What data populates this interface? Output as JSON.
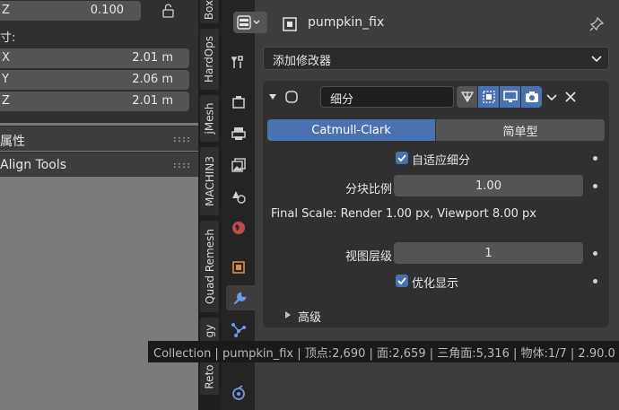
{
  "transform": {
    "scale_z": {
      "axis": "Z",
      "value": "0.100"
    },
    "dimensions_label": "寸:",
    "dimensions": [
      {
        "axis": "X",
        "value": "2.01 m"
      },
      {
        "axis": "Y",
        "value": "2.06 m"
      },
      {
        "axis": "Z",
        "value": "2.01 m"
      }
    ]
  },
  "panels": {
    "properties": "属性",
    "align_tools": "Align Tools"
  },
  "tabs": [
    "Box",
    "HardOps",
    "Mesh",
    "MACHIN3",
    "Quad Remesh",
    "Retopology"
  ],
  "tab_visible_text": {
    "box": "Box",
    "hardops": "HardOps",
    "mesh": "jMesh",
    "machin3": "MACHIN3",
    "quad": "Quad Remesh",
    "retopo": "Reto",
    "retopo2": "gy"
  },
  "properties": {
    "object_name": "pumpkin_fix",
    "add_modifier": "添加修改器",
    "modifier": {
      "name": "细分",
      "methods": [
        "Catmull-Clark",
        "简单型"
      ],
      "active_method": "Catmull-Clark",
      "adaptive_label": "自适应细分",
      "adaptive_checked": true,
      "dicing_label": "分块比例",
      "dicing_value": "1.00",
      "final_scale": "Final Scale: Render 1.00 px, Viewport 8.00 px",
      "viewport_levels_label": "视图层级",
      "viewport_levels_value": "1",
      "optimal_display_label": "优化显示",
      "optimal_display_checked": true,
      "advanced_label": "高级"
    }
  },
  "status_bar": "Collection | pumpkin_fix | 顶点:2,690 | 面:2,659 | 三角面:5,316 | 物体:1/7 | 2.90.0",
  "colors": {
    "accent": "#4a72b0",
    "panel": "#303030",
    "field": "#545454",
    "background": "#3d3d3d"
  }
}
